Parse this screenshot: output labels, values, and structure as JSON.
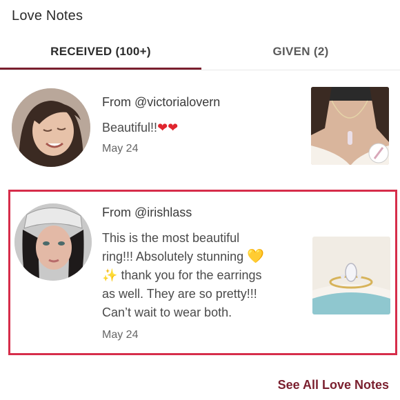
{
  "header": {
    "title": "Love Notes"
  },
  "tabs": [
    {
      "label": "RECEIVED (100+)",
      "active": true
    },
    {
      "label": "GIVEN (2)",
      "active": false
    }
  ],
  "notes": [
    {
      "from": "From @victorialovern",
      "message": "Beautiful!!",
      "emoji": "❤❤",
      "date": "May 24",
      "avatar_icon": "avatar-photo",
      "thumb_icon": "necklace-product-photo"
    },
    {
      "from": "From @irishlass",
      "message_line1": "This is the most beautiful",
      "message_line2": "ring!!! Absolutely stunning",
      "emoji_heart": "💛",
      "emoji_sparkle": "✨",
      "message_line3": "thank you for the earrings",
      "message_line4": "as well. They are so pretty!!!",
      "message_line5": "Can’t wait to wear both.",
      "date": "May 24",
      "avatar_icon": "avatar-photo",
      "thumb_icon": "ring-product-photo",
      "highlighted": true
    }
  ],
  "footer": {
    "link_label": "See All Love Notes"
  },
  "colors": {
    "accent": "#7a1f2e",
    "highlight_border": "#d62d4a"
  }
}
